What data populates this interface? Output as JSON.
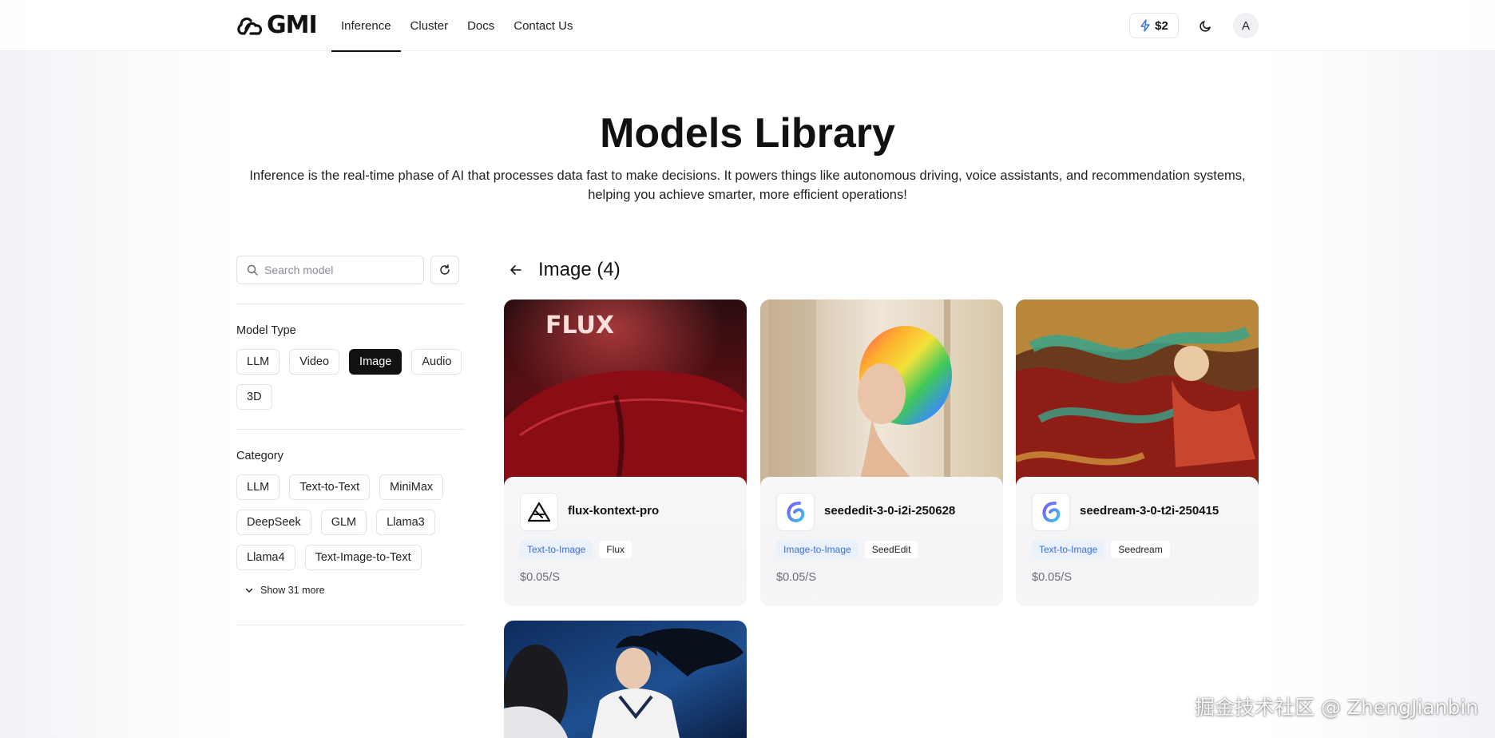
{
  "header": {
    "brand": "GMI",
    "nav": [
      {
        "label": "Inference",
        "active": true
      },
      {
        "label": "Cluster",
        "active": false
      },
      {
        "label": "Docs",
        "active": false
      },
      {
        "label": "Contact Us",
        "active": false
      }
    ],
    "credit": "$2",
    "avatar_letter": "A",
    "icons": {
      "credit": "lightning-icon",
      "theme": "moon-icon"
    }
  },
  "hero": {
    "title": "Models Library",
    "description_line1": "Inference is the real-time phase of AI that processes data fast to make decisions. It powers things like autonomous driving, voice assistants, and recommendation systems,",
    "description_line2": "helping you achieve smarter, more efficient operations!"
  },
  "sidebar": {
    "search_placeholder": "Search model",
    "model_type_label": "Model Type",
    "model_types": [
      {
        "label": "LLM",
        "selected": false
      },
      {
        "label": "Video",
        "selected": false
      },
      {
        "label": "Image",
        "selected": true
      },
      {
        "label": "Audio",
        "selected": false
      },
      {
        "label": "3D",
        "selected": false
      }
    ],
    "category_label": "Category",
    "categories": [
      {
        "label": "LLM"
      },
      {
        "label": "Text-to-Text"
      },
      {
        "label": "MiniMax"
      },
      {
        "label": "DeepSeek"
      },
      {
        "label": "GLM"
      },
      {
        "label": "Llama3"
      },
      {
        "label": "Llama4"
      },
      {
        "label": "Text-Image-to-Text"
      }
    ],
    "show_more": "Show 31 more"
  },
  "main": {
    "title": "Image (4)",
    "cards": [
      {
        "name": "flux-kontext-pro",
        "type_tag": "Text-to-Image",
        "family_tag": "Flux",
        "price": "$0.05/S",
        "logo": "flux-logo-icon",
        "image_text": "FLUX"
      },
      {
        "name": "seededit-3-0-i2i-250628",
        "type_tag": "Image-to-Image",
        "family_tag": "SeedEdit",
        "price": "$0.05/S",
        "logo": "seed-logo-icon"
      },
      {
        "name": "seedream-3-0-t2i-250415",
        "type_tag": "Text-to-Image",
        "family_tag": "Seedream",
        "price": "$0.05/S",
        "logo": "seed-logo-icon"
      }
    ]
  },
  "watermark": "掘金技术社区 @ ZhengJianbin",
  "colors": {
    "accent_blue": "#3a6fd8",
    "tag_blue_bg": "#eaf1fc",
    "selected_chip": "#111111"
  }
}
